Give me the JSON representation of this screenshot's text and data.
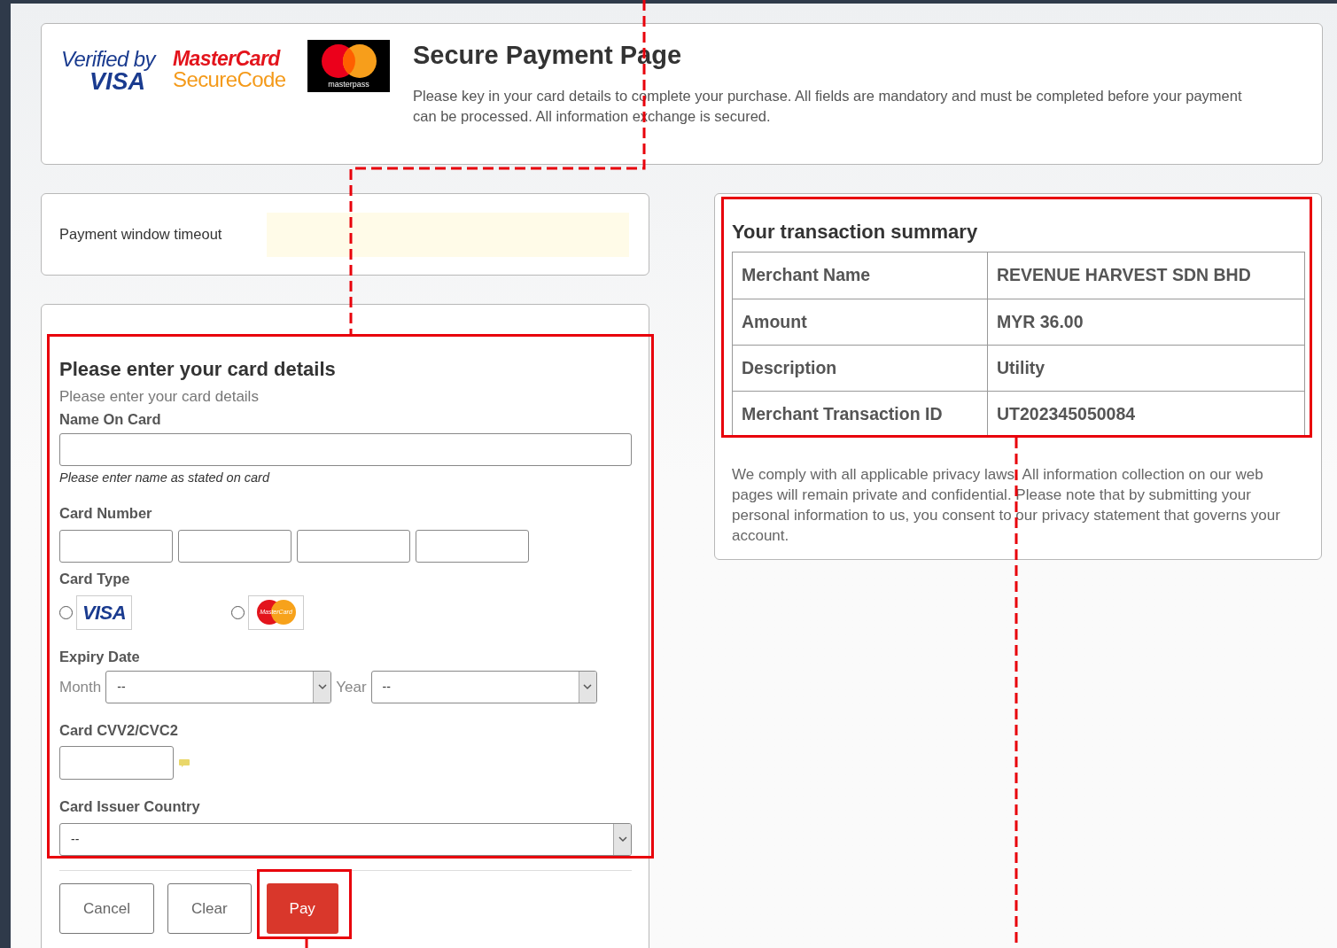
{
  "logos": {
    "verified_by": "Verified by",
    "visa": "VISA",
    "mastercard": "MasterCard",
    "securecode": "SecureCode",
    "masterpass": "masterpass"
  },
  "header": {
    "title": "Secure Payment Page",
    "text": "Please key in your card details to complete your purchase. All fields are mandatory and must be completed before your payment can be processed. All information exchange is secured."
  },
  "timeout": {
    "label": "Payment window timeout"
  },
  "form": {
    "title": "Please enter your card details",
    "subtitle": "Please enter your card details",
    "name_label": "Name On Card",
    "name_hint": "Please enter name as stated on card",
    "card_number_label": "Card Number",
    "card_type_label": "Card Type",
    "card_types": [
      {
        "kind": "visa",
        "label": "VISA",
        "selected": false
      },
      {
        "kind": "mastercard",
        "label": "MasterCard",
        "selected": false
      }
    ],
    "expiry_label": "Expiry Date",
    "month_label": "Month",
    "month_value": "--",
    "year_label": "Year",
    "year_value": "--",
    "cvv_label": "Card CVV2/CVC2",
    "country_label": "Card Issuer Country",
    "country_value": "--"
  },
  "buttons": [
    {
      "label": "Cancel",
      "kind": "default"
    },
    {
      "label": "Clear",
      "kind": "default"
    },
    {
      "label": "Pay",
      "kind": "primary"
    }
  ],
  "summary": {
    "title": "Your transaction summary",
    "rows": [
      {
        "label": "Merchant Name",
        "value": "REVENUE HARVEST SDN BHD"
      },
      {
        "label": "Amount",
        "value": "MYR 36.00"
      },
      {
        "label": "Description",
        "value": "Utility"
      },
      {
        "label": "Merchant Transaction ID",
        "value": "UT202345050084"
      }
    ],
    "note": "We comply with all applicable privacy laws. All information collection on our web pages will remain private and confidential. Please note that by submitting your personal information to us, you consent to our privacy statement that governs your account."
  }
}
